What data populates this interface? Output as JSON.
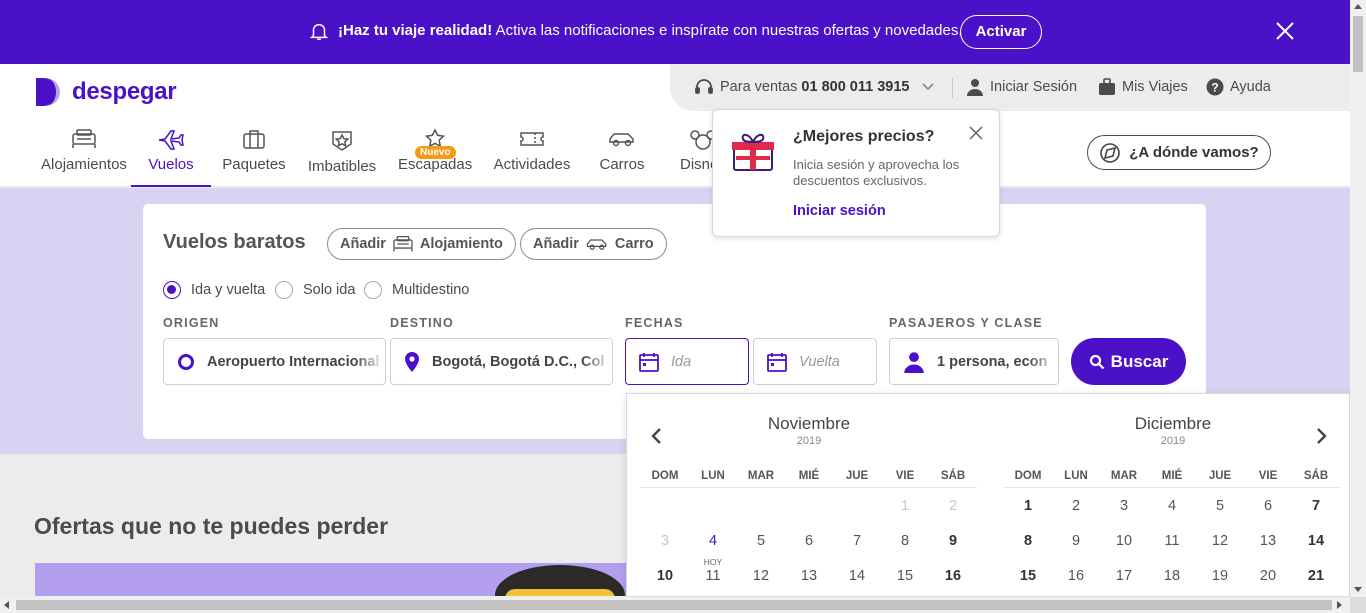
{
  "banner": {
    "bold": "¡Haz tu viaje realidad!",
    "text": " Activa las notificaciones e inspírate con nuestras ofertas y novedades.",
    "button": "Activar",
    "icon": "bell-icon",
    "close_icon": "close-icon"
  },
  "brand": {
    "name": "despegar",
    "color": "#4a11c9"
  },
  "topbar": {
    "sales_prefix": "Para ventas ",
    "sales_phone": "01 800 011 3915",
    "login": "Iniciar Sesión",
    "trips": "Mis Viajes",
    "help": "Ayuda"
  },
  "nav": {
    "tabs": [
      {
        "label": "Alojamientos",
        "icon": "bed-icon"
      },
      {
        "label": "Vuelos",
        "icon": "plane-icon",
        "active": true
      },
      {
        "label": "Paquetes",
        "icon": "suitcase-icon"
      },
      {
        "label": "Imbatibles",
        "icon": "badge-star-icon"
      },
      {
        "label": "Escapadas",
        "icon": "stars-icon",
        "badge": "Nuevo"
      },
      {
        "label": "Actividades",
        "icon": "ticket-icon"
      },
      {
        "label": "Carros",
        "icon": "car-icon"
      },
      {
        "label": "Disne",
        "icon": "mickey-icon"
      }
    ]
  },
  "where_button": "¿A dónde vamos?",
  "popover": {
    "title": "¿Mejores precios?",
    "text": "Inicia sesión y aprovecha los descuentos exclusivos.",
    "link": "Iniciar sesión"
  },
  "search": {
    "title": "Vuelos baratos",
    "add_prefix": "Añadir",
    "add_hotel": "Alojamiento",
    "add_car": "Carro",
    "trip_types": [
      "Ida y vuelta",
      "Solo ida",
      "Multidestino"
    ],
    "selected_trip_type": "Ida y vuelta",
    "labels": {
      "origin": "ORIGEN",
      "destination": "DESTINO",
      "dates": "FECHAS",
      "passengers": "PASAJEROS Y CLASE"
    },
    "origin_value": "Aeropuerto Internacional",
    "destination_value": "Bogotá, Bogotá D.C., Col",
    "depart_placeholder": "Ida",
    "return_placeholder": "Vuelta",
    "passengers_value": "1 persona, econ",
    "button": "Buscar"
  },
  "offers_title": "Ofertas que no te puedes perder",
  "calendar": {
    "weekdays": [
      "DOM",
      "LUN",
      "MAR",
      "MIÉ",
      "JUE",
      "VIE",
      "SÁB"
    ],
    "today_label": "HOY",
    "months": [
      {
        "name": "Noviembre",
        "year": "2019",
        "rows": [
          [
            "",
            "",
            "",
            "",
            "",
            "1",
            "2"
          ],
          [
            "3",
            "4",
            "5",
            "6",
            "7",
            "8",
            "9"
          ],
          [
            "10",
            "11",
            "12",
            "13",
            "14",
            "15",
            "16"
          ]
        ]
      },
      {
        "name": "Diciembre",
        "year": "2019",
        "rows": [
          [
            "1",
            "2",
            "3",
            "4",
            "5",
            "6",
            "7"
          ],
          [
            "8",
            "9",
            "10",
            "11",
            "12",
            "13",
            "14"
          ],
          [
            "15",
            "16",
            "17",
            "18",
            "19",
            "20",
            "21"
          ]
        ]
      }
    ]
  }
}
